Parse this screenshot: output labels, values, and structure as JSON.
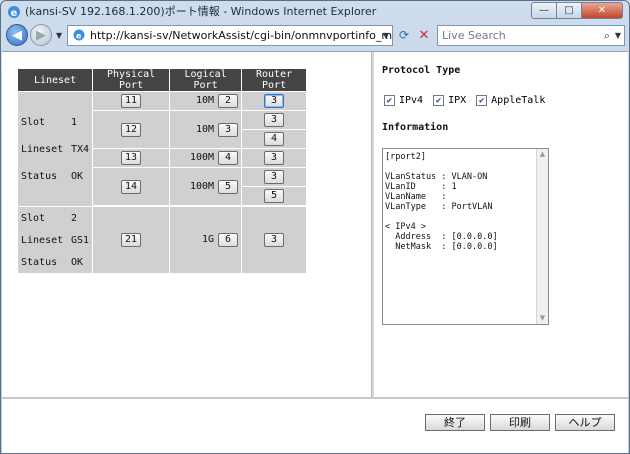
{
  "window": {
    "title": "(kansi-SV 192.168.1.200)ポート情報 - Windows Internet Explorer",
    "minimize": "—",
    "maximize": "□",
    "close": "✕"
  },
  "nav": {
    "address": "http://kansi-sv/NetworkAssist/cgi-bin/onmnvportinfo_main.cg",
    "search_placeholder": "Live Search"
  },
  "ports_table": {
    "headers": [
      "Lineset",
      "Physical Port",
      "Logical Port",
      "Router Port"
    ],
    "groups": [
      {
        "slot_label": "Slot",
        "slot": "1",
        "lineset_label": "Lineset",
        "lineset": "TX4",
        "status_label": "Status",
        "status": "OK",
        "rows": [
          {
            "physical": "11",
            "speed": "10M",
            "logical": "2",
            "router": [
              "3"
            ]
          },
          {
            "physical": "12",
            "speed": "10M",
            "logical": "3",
            "router": [
              "3",
              "4"
            ]
          },
          {
            "physical": "13",
            "speed": "100M",
            "logical": "4",
            "router": [
              "3"
            ]
          },
          {
            "physical": "14",
            "speed": "100M",
            "logical": "5",
            "router": [
              "3",
              "5"
            ]
          }
        ]
      },
      {
        "slot_label": "Slot",
        "slot": "2",
        "lineset_label": "Lineset",
        "lineset": "GS1",
        "status_label": "Status",
        "status": "OK",
        "rows": [
          {
            "physical": "21",
            "speed": "1G",
            "logical": "6",
            "router": [
              "3"
            ]
          }
        ]
      }
    ]
  },
  "protocol": {
    "title": "Protocol Type",
    "options": [
      {
        "label": "IPv4",
        "checked": true
      },
      {
        "label": "IPX",
        "checked": true
      },
      {
        "label": "AppleTalk",
        "checked": true
      }
    ]
  },
  "information": {
    "title": "Information",
    "text": "[rport2]\n\nVLanStatus : VLAN-ON\nVLanID     : 1\nVLanName   :\nVLanType   : PortVLAN\n\n< IPv4 >\n  Address  : [0.0.0.0]\n  NetMask  : [0.0.0.0]"
  },
  "buttons": {
    "end": "終了",
    "print": "印刷",
    "help": "ヘルプ"
  }
}
